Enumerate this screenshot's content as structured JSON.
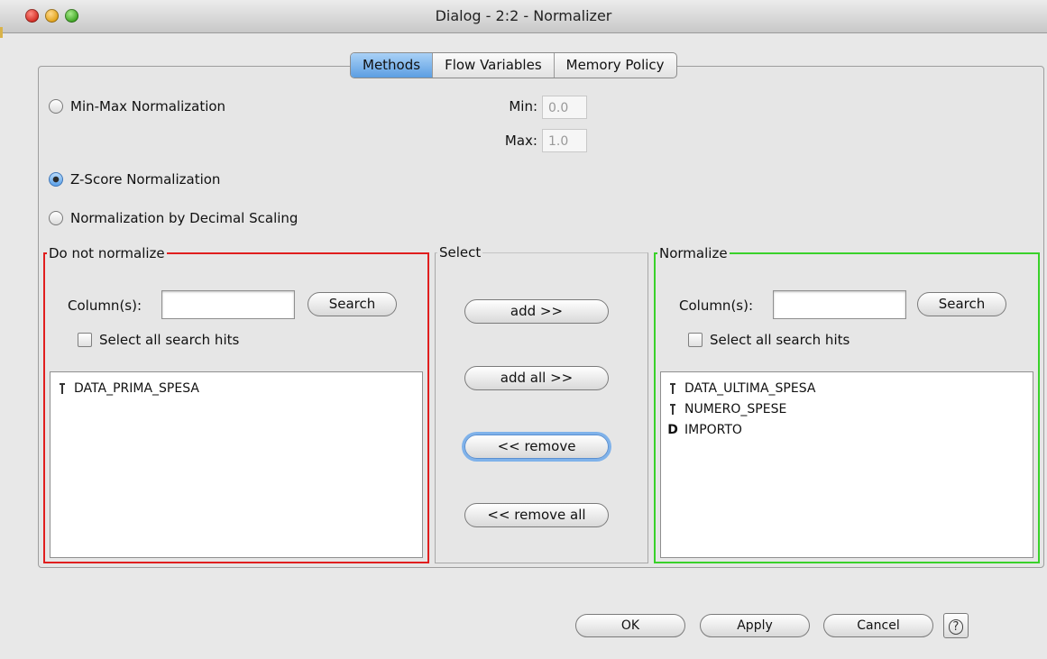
{
  "window": {
    "title": "Dialog - 2:2 - Normalizer"
  },
  "tabs": [
    {
      "label": "Methods",
      "selected": true
    },
    {
      "label": "Flow Variables",
      "selected": false
    },
    {
      "label": "Memory Policy",
      "selected": false
    }
  ],
  "methods": {
    "minmax": {
      "label": "Min-Max Normalization",
      "selected": false
    },
    "min": {
      "label": "Min:",
      "value": "0.0"
    },
    "max": {
      "label": "Max:",
      "value": "1.0"
    },
    "zscore": {
      "label": "Z-Score Normalization",
      "selected": true
    },
    "decimal": {
      "label": "Normalization by Decimal Scaling",
      "selected": false
    }
  },
  "exclude": {
    "title": "Do not normalize",
    "column_label": "Column(s):",
    "search_value": "",
    "search_button": "Search",
    "select_all_label": "Select all search hits",
    "items": [
      {
        "name": "DATA_PRIMA_SPESA",
        "type_icon": "integer-column-icon",
        "type_glyph": "I"
      }
    ]
  },
  "select": {
    "title": "Select",
    "add": "add >>",
    "add_all": "add all >>",
    "remove": "<< remove",
    "remove_all": "<< remove all"
  },
  "include": {
    "title": "Normalize",
    "column_label": "Column(s):",
    "search_value": "",
    "search_button": "Search",
    "select_all_label": "Select all search hits",
    "items": [
      {
        "name": "DATA_ULTIMA_SPESA",
        "type_icon": "integer-column-icon",
        "type_glyph": "I"
      },
      {
        "name": "NUMERO_SPESE",
        "type_icon": "integer-column-icon",
        "type_glyph": "I"
      },
      {
        "name": "IMPORTO",
        "type_icon": "double-column-icon",
        "type_glyph": "D"
      }
    ]
  },
  "footer": {
    "ok": "OK",
    "apply": "Apply",
    "cancel": "Cancel",
    "help": "?"
  },
  "colors": {
    "exclude_border": "#e01e1e",
    "include_border": "#39d12a",
    "selected_tab": "#5c9ee2"
  }
}
